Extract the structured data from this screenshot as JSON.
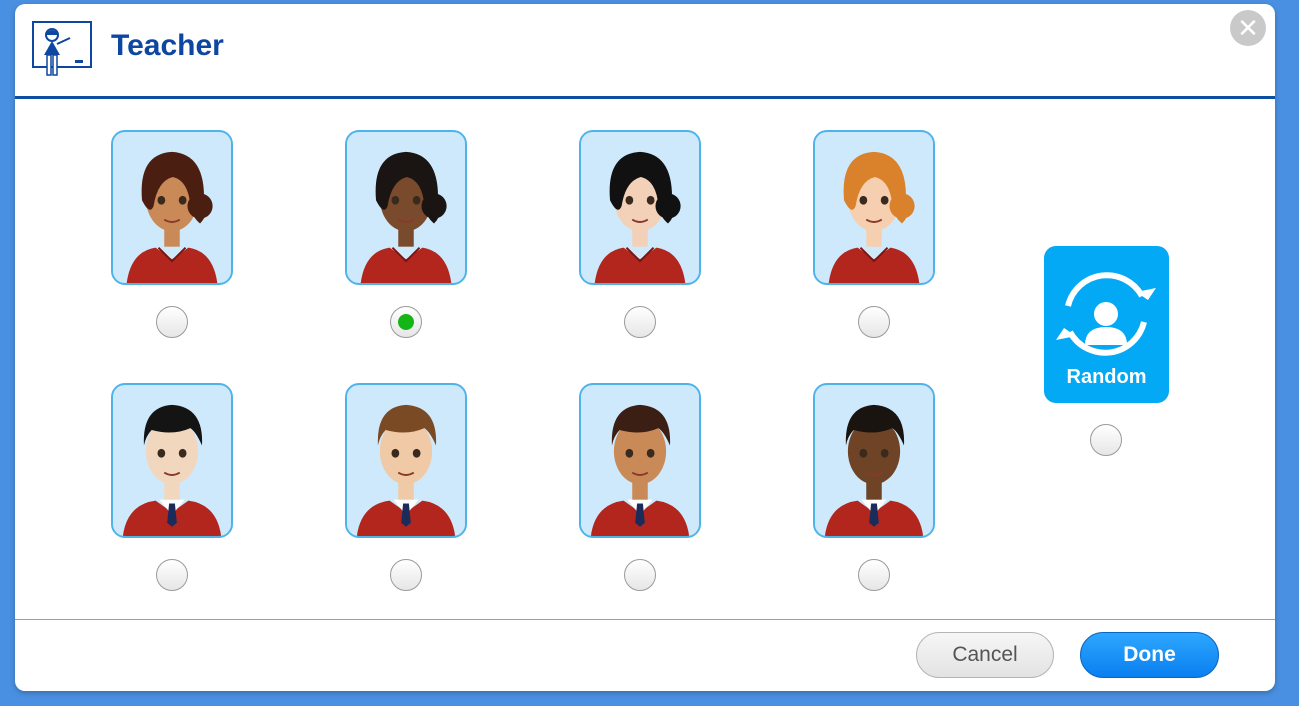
{
  "dialog": {
    "title": "Teacher",
    "close_icon": "close-icon",
    "header_icon": "teacher-at-board-icon"
  },
  "avatars": [
    {
      "id": "female-1",
      "skin": "#c98a58",
      "hair": "#4a1f12",
      "clothing": "shirt",
      "selected": false
    },
    {
      "id": "female-2",
      "skin": "#7a4a2c",
      "hair": "#1a1412",
      "clothing": "shirt",
      "selected": true
    },
    {
      "id": "female-3",
      "skin": "#f2d1b8",
      "hair": "#111111",
      "clothing": "shirt",
      "selected": false
    },
    {
      "id": "female-4",
      "skin": "#f6cfb0",
      "hair": "#d9822b",
      "clothing": "shirt",
      "selected": false
    },
    {
      "id": "male-1",
      "skin": "#f2d7bf",
      "hair": "#141414",
      "clothing": "sweater",
      "selected": false
    },
    {
      "id": "male-2",
      "skin": "#f0c9a6",
      "hair": "#7a4a24",
      "clothing": "sweater",
      "selected": false
    },
    {
      "id": "male-3",
      "skin": "#c98a58",
      "hair": "#3b1f14",
      "clothing": "sweater",
      "selected": false
    },
    {
      "id": "male-4",
      "skin": "#6e4326",
      "hair": "#1a1410",
      "clothing": "sweater",
      "selected": false
    }
  ],
  "random": {
    "label": "Random",
    "icon": "random-user-icon",
    "selected": false
  },
  "footer": {
    "cancel_label": "Cancel",
    "done_label": "Done"
  },
  "colors": {
    "accent": "#0d47a1",
    "avatar_bg": "#cde9fb",
    "avatar_border": "#4fb3ea",
    "random_bg": "#03a9f4",
    "selected_dot": "#16b516",
    "done_button": "#1a8ff7"
  }
}
